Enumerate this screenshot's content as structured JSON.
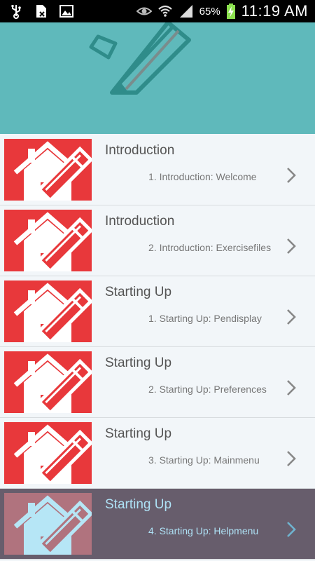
{
  "status_bar": {
    "battery": "65%",
    "time": "11:19 AM"
  },
  "lessons": [
    {
      "title": "Introduction",
      "subtitle": "1. Introduction: Welcome",
      "selected": false
    },
    {
      "title": "Introduction",
      "subtitle": "2. Introduction: Exercisefiles",
      "selected": false
    },
    {
      "title": "Starting Up",
      "subtitle": "1. Starting Up: Pendisplay",
      "selected": false
    },
    {
      "title": "Starting Up",
      "subtitle": "2. Starting Up: Preferences",
      "selected": false
    },
    {
      "title": "Starting Up",
      "subtitle": "3. Starting Up: Mainmenu",
      "selected": false
    },
    {
      "title": "Starting Up",
      "subtitle": "4. Starting Up: Helpmenu",
      "selected": true
    }
  ],
  "colors": {
    "banner": "#5fb9bb",
    "thumbnail": "#e8383b",
    "selected_row": "#675d6c"
  }
}
